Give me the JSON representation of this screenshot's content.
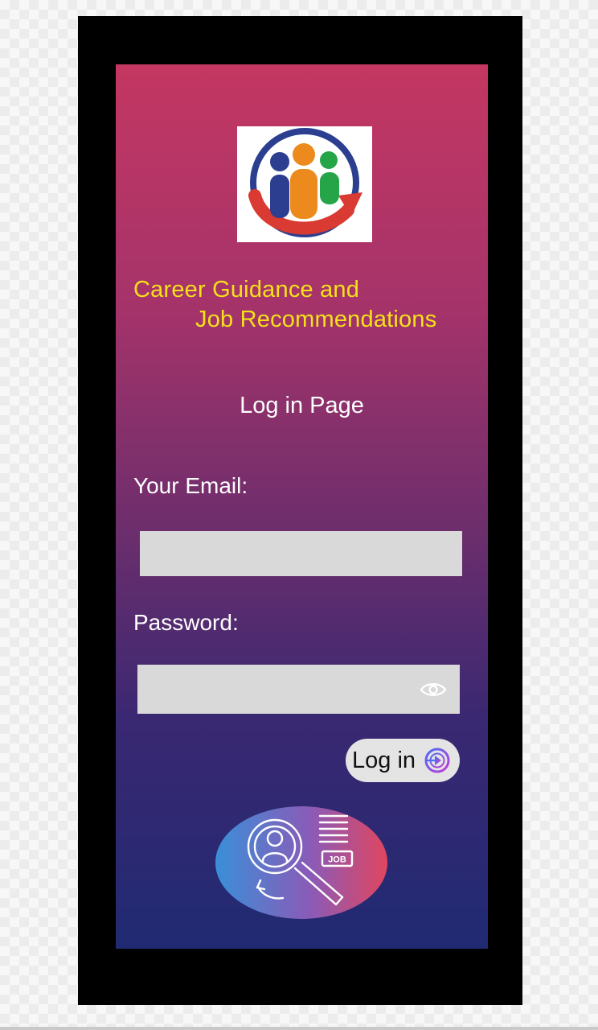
{
  "app": {
    "title_line1": "Career Guidance and",
    "title_line2": "Job Recommendations",
    "logo_icon": "people-growth-arrow-icon"
  },
  "page": {
    "heading": "Log in Page"
  },
  "form": {
    "email_label": "Your Email:",
    "email_value": "",
    "password_label": "Password:",
    "password_value": "",
    "password_visibility_icon": "eye-icon",
    "login_label": "Log in",
    "login_icon": "arrow-right-circle-icon"
  },
  "illustration": {
    "badge_text": "JOB",
    "icon": "job-search-magnifier-icon"
  },
  "colors": {
    "title_text": "#f4e11a",
    "gradient_top": "#c43762",
    "gradient_bottom": "#202a72",
    "input_background": "#d9d9d9",
    "button_background": "#e4e4e4",
    "frame": "#000000"
  }
}
